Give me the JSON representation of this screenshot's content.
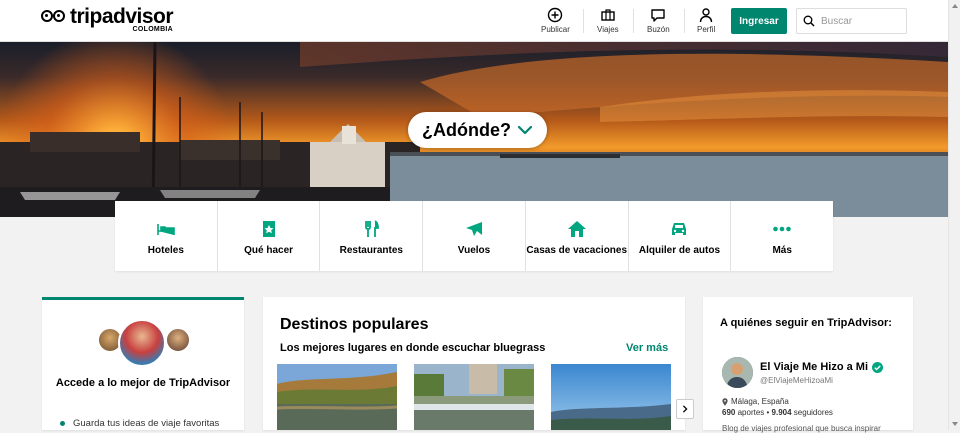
{
  "brand": {
    "name": "tripadvisor",
    "country": "COLOMBIA",
    "accent_color": "#00856f"
  },
  "header": {
    "nav": [
      {
        "label": "Publicar",
        "icon": "plus-circle-icon"
      },
      {
        "label": "Viajes",
        "icon": "briefcase-icon"
      },
      {
        "label": "Buzón",
        "icon": "chat-bubble-icon"
      },
      {
        "label": "Perfil",
        "icon": "person-icon"
      }
    ],
    "login_label": "Ingresar",
    "search_placeholder": "Buscar"
  },
  "hero": {
    "prompt": "¿Adónde?"
  },
  "categories": [
    {
      "label": "Hoteles",
      "icon": "bed-icon"
    },
    {
      "label": "Qué hacer",
      "icon": "ticket-icon"
    },
    {
      "label": "Restaurantes",
      "icon": "fork-knife-icon"
    },
    {
      "label": "Vuelos",
      "icon": "plane-icon"
    },
    {
      "label": "Casas de vacaciones",
      "icon": "house-icon"
    },
    {
      "label": "Alquiler de autos",
      "icon": "car-icon"
    },
    {
      "label": "Más",
      "icon": "more-dots-icon"
    }
  ],
  "signin_card": {
    "title": "Accede a lo mejor de TripAdvisor",
    "bullet": "Guarda tus ideas de viaje favoritas"
  },
  "destinations": {
    "title": "Destinos populares",
    "subtitle": "Los mejores lugares en donde escuchar bluegrass",
    "see_more": "Ver más"
  },
  "follow": {
    "title": "A quiénes seguir en TripAdvisor:",
    "profile": {
      "name": "El Viaje Me Hizo a Mi",
      "handle": "@ElViajeMeHizoaMi",
      "location": "Málaga, España",
      "contributions": "690",
      "contributions_label": "aportes",
      "followers": "9.904",
      "followers_label": "seguidores",
      "bio": "Blog de viajes profesional que busca inspirar"
    }
  }
}
